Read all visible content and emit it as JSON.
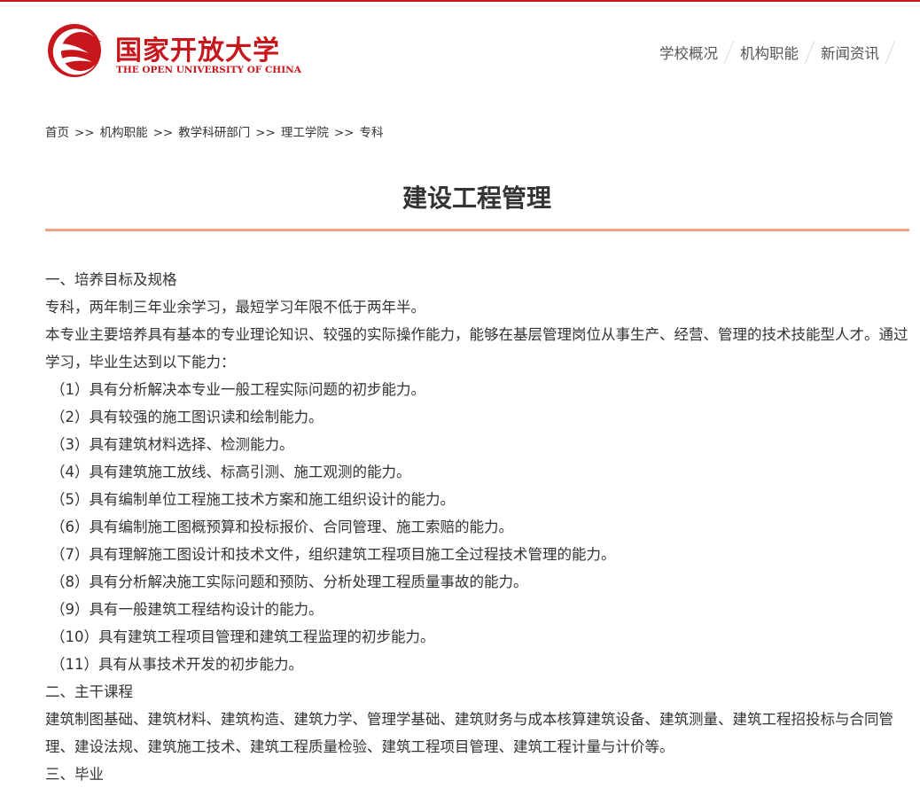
{
  "brand": {
    "name_cn": "国家开放大学",
    "name_en": "THE OPEN UNIVERSITY OF CHINA",
    "color": "#c8161d"
  },
  "nav": {
    "items": [
      {
        "label": "学校概况"
      },
      {
        "label": "机构职能"
      },
      {
        "label": "新闻资讯"
      }
    ]
  },
  "breadcrumb": {
    "separator": ">>",
    "items": [
      {
        "label": "首页"
      },
      {
        "label": "机构职能"
      },
      {
        "label": "教学科研部门"
      },
      {
        "label": "理工学院"
      },
      {
        "label": "专科"
      }
    ]
  },
  "page": {
    "title": "建设工程管理",
    "rule_color": "#f2a283"
  },
  "content": {
    "section1_heading": "一、培养目标及规格",
    "section1_intro1": "专科，两年制三年业余学习，最短学习年限不低于两年半。",
    "section1_intro2": "本专业主要培养具有基本的专业理论知识、较强的实际操作能力，能够在基层管理岗位从事生产、经营、管理的技术技能型人才。通过学习，毕业生达到以下能力：",
    "abilities": [
      "（1）具有分析解决本专业一般工程实际问题的初步能力。",
      "（2）具有较强的施工图识读和绘制能力。",
      "（3）具有建筑材料选择、检测能力。",
      "（4）具有建筑施工放线、标高引测、施工观测的能力。",
      "（5）具有编制单位工程施工技术方案和施工组织设计的能力。",
      "（6）具有编制施工图概预算和投标报价、合同管理、施工索赔的能力。",
      "（7）具有理解施工图设计和技术文件，组织建筑工程项目施工全过程技术管理的能力。",
      "（8）具有分析解决施工实际问题和预防、分析处理工程质量事故的能力。",
      "（9）具有一般建筑工程结构设计的能力。",
      "（10）具有建筑工程项目管理和建筑工程监理的初步能力。",
      "（11）具有从事技术开发的初步能力。"
    ],
    "section2_heading": "二、主干课程",
    "section2_text": "建筑制图基础、建筑材料、建筑构造、建筑力学、管理学基础、建筑财务与成本核算建筑设备、建筑测量、建筑工程招投标与合同管理、建设法规、建筑施工技术、建筑工程质量检验、建筑工程项目管理、建筑工程计量与计价等。",
    "section3_heading": "三、毕业"
  }
}
